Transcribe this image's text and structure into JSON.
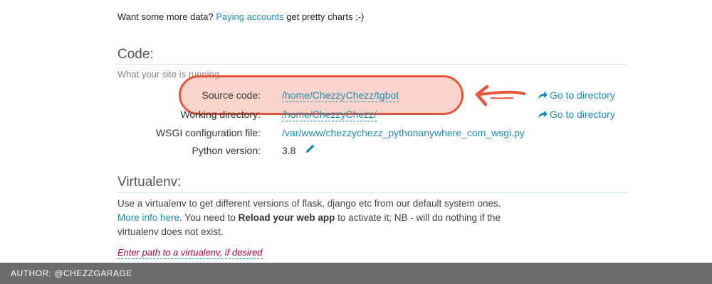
{
  "promo": {
    "prefix": "Want some more data? ",
    "link": "Paying accounts",
    "suffix": " get pretty charts ;-)"
  },
  "code_section": {
    "title": "Code:",
    "subtitle": "What your site is running.",
    "rows": [
      {
        "label": "Source code:",
        "value": "/home/ChezzyChezz/tgbot",
        "action": "Go to directory"
      },
      {
        "label": "Working directory:",
        "value": "/home/ChezzyChezz/",
        "action": "Go to directory"
      },
      {
        "label": "WSGI configuration file:",
        "value": "/var/www/chezzychezz_pythonanywhere_com_wsgi.py"
      },
      {
        "label": "Python version:",
        "value": "3.8"
      }
    ]
  },
  "virtualenv_section": {
    "title": "Virtualenv:",
    "line1": "Use a virtualenv to get different versions of flask, django etc from our default system ones.",
    "more_info_link": "More info here",
    "line2_mid": ". You need to ",
    "line2_bold": "Reload your web app",
    "line2_end": " to activate it; NB - will do nothing if the",
    "line3": "virtualenv does not exist.",
    "input_placeholder": "Enter path to a virtualenv, if desired"
  },
  "footer": {
    "author": "AUTHOR:  @CHEZZGARAGE"
  },
  "colors": {
    "link": "#1a8fb5",
    "highlight_border": "#e8553a",
    "highlight_fill": "#f3a08c",
    "footer_bg": "#6d6d6d",
    "placeholder": "#b00040"
  },
  "icons": {
    "goto": "share-arrow-icon",
    "edit": "pencil-icon",
    "annotation": "hand-drawn-arrow"
  }
}
